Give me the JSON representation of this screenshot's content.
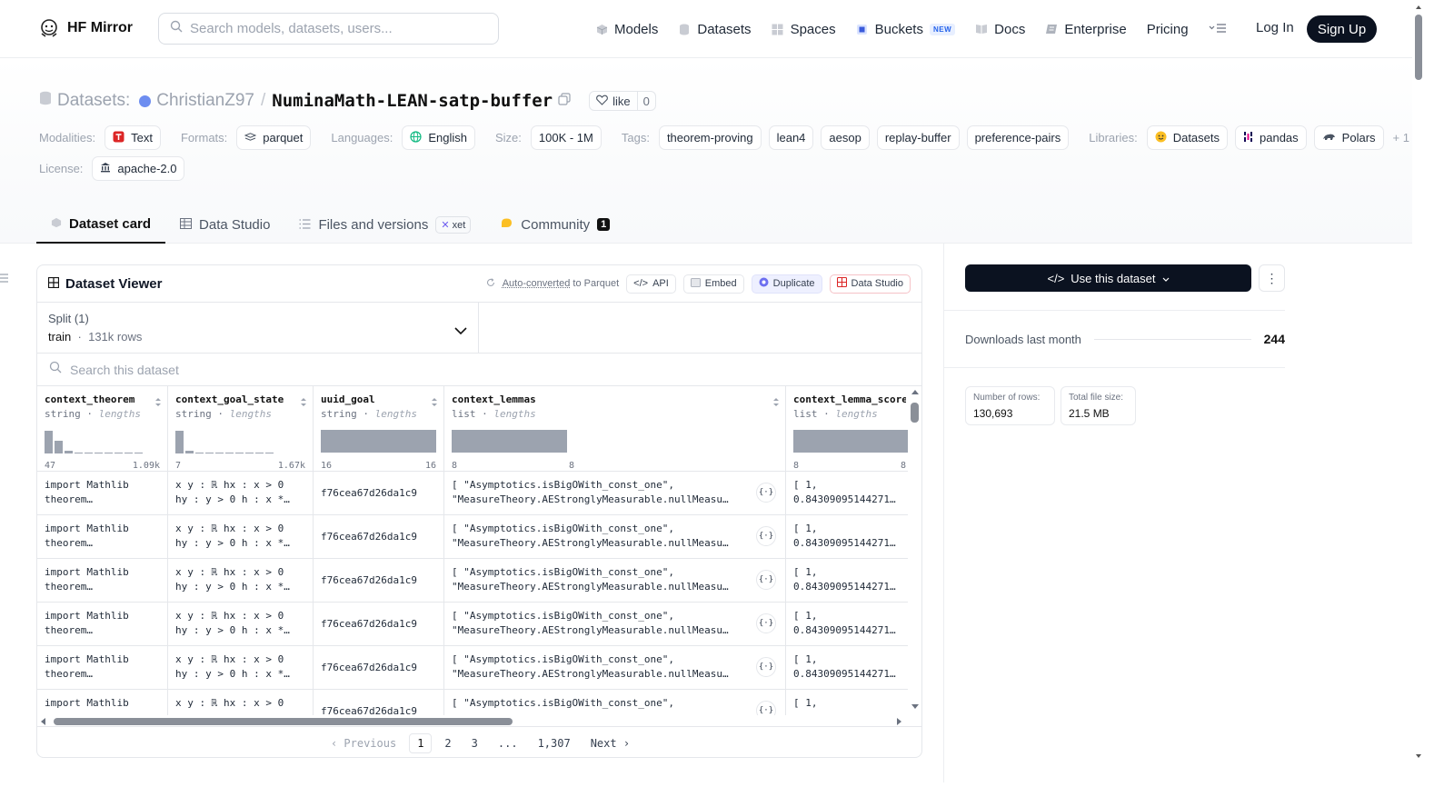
{
  "nav": {
    "brand": "HF Mirror",
    "search_placeholder": "Search models, datasets, users...",
    "links": [
      {
        "label": "Models",
        "icon": "cube-icon"
      },
      {
        "label": "Datasets",
        "icon": "database-icon"
      },
      {
        "label": "Spaces",
        "icon": "grid-icon"
      },
      {
        "label": "Buckets",
        "icon": "bucket-icon",
        "badge": "NEW"
      },
      {
        "label": "Docs",
        "icon": "book-icon"
      },
      {
        "label": "Enterprise",
        "icon": "enterprise-icon"
      },
      {
        "label": "Pricing"
      }
    ],
    "login": "Log In",
    "signup": "Sign Up"
  },
  "crumb": {
    "prefix": "Datasets:",
    "owner": "ChristianZ97",
    "name": "NuminaMath-LEAN-satp-buffer",
    "like_label": "like",
    "like_count": "0"
  },
  "meta": {
    "modalities_label": "Modalities:",
    "modality": "Text",
    "formats_label": "Formats:",
    "format": "parquet",
    "languages_label": "Languages:",
    "language": "English",
    "size_label": "Size:",
    "size": "100K - 1M",
    "tags_label": "Tags:",
    "tags": [
      "theorem-proving",
      "lean4",
      "aesop",
      "replay-buffer",
      "preference-pairs"
    ],
    "libraries_label": "Libraries:",
    "libraries": [
      "Datasets",
      "pandas",
      "Polars"
    ],
    "more_libraries": "+ 1",
    "license_label": "License:",
    "license": "apache-2.0"
  },
  "tabs": [
    {
      "label": "Dataset card",
      "active": true
    },
    {
      "label": "Data Studio"
    },
    {
      "label": "Files and versions",
      "badge": "xet"
    },
    {
      "label": "Community",
      "count": "1"
    }
  ],
  "viewer": {
    "title": "Dataset Viewer",
    "auto_converted": "Auto-converted",
    "to_parquet": "to Parquet",
    "api": "API",
    "embed": "Embed",
    "duplicate": "Duplicate",
    "data_studio": "Data Studio",
    "split_label": "Split (1)",
    "split_name": "train",
    "split_rows": "131k rows",
    "search_placeholder": "Search this dataset",
    "columns": [
      {
        "name": "context_theorem",
        "type": "string",
        "sub": "lengths",
        "min": "47",
        "max": "1.09k"
      },
      {
        "name": "context_goal_state",
        "type": "string",
        "sub": "lengths",
        "min": "7",
        "max": "1.67k"
      },
      {
        "name": "uuid_goal",
        "type": "string",
        "sub": "lengths",
        "min": "16",
        "max": "16"
      },
      {
        "name": "context_lemmas",
        "type": "list",
        "sub": "lengths",
        "min": "8",
        "max": "8"
      },
      {
        "name": "context_lemma_scores",
        "type": "list",
        "sub": "lengths",
        "min": "8",
        "max": "8"
      }
    ],
    "rows": [
      [
        "import Mathlib\ntheorem…",
        "x y : ℝ hx : x > 0\nhy : y > 0 h : x *…",
        "f76cea67d26da1c9",
        "[ \"Asymptotics.isBigOWith_const_one\",\n\"MeasureTheory.AEStronglyMeasurable.nullMeasu…",
        "[ 1,\n0.84309095144271…"
      ],
      [
        "import Mathlib\ntheorem…",
        "x y : ℝ hx : x > 0\nhy : y > 0 h : x *…",
        "f76cea67d26da1c9",
        "[ \"Asymptotics.isBigOWith_const_one\",\n\"MeasureTheory.AEStronglyMeasurable.nullMeasu…",
        "[ 1,\n0.84309095144271…"
      ],
      [
        "import Mathlib\ntheorem…",
        "x y : ℝ hx : x > 0\nhy : y > 0 h : x *…",
        "f76cea67d26da1c9",
        "[ \"Asymptotics.isBigOWith_const_one\",\n\"MeasureTheory.AEStronglyMeasurable.nullMeasu…",
        "[ 1,\n0.84309095144271…"
      ],
      [
        "import Mathlib\ntheorem…",
        "x y : ℝ hx : x > 0\nhy : y > 0 h : x *…",
        "f76cea67d26da1c9",
        "[ \"Asymptotics.isBigOWith_const_one\",\n\"MeasureTheory.AEStronglyMeasurable.nullMeasu…",
        "[ 1,\n0.84309095144271…"
      ],
      [
        "import Mathlib\ntheorem…",
        "x y : ℝ hx : x > 0\nhy : y > 0 h : x *…",
        "f76cea67d26da1c9",
        "[ \"Asymptotics.isBigOWith_const_one\",\n\"MeasureTheory.AEStronglyMeasurable.nullMeasu…",
        "[ 1,\n0.84309095144271…"
      ],
      [
        "import Mathlib",
        "x y : ℝ hx : x > 0",
        "f76cea67d26da1c9",
        "[ \"Asymptotics.isBigOWith_const_one\",",
        "[ 1,"
      ]
    ],
    "pager": {
      "prev": "Previous",
      "pages": [
        "1",
        "2",
        "3",
        "...",
        "1,307"
      ],
      "next": "Next"
    }
  },
  "sidebar": {
    "use_dataset": "Use this dataset",
    "downloads_label": "Downloads last month",
    "downloads": "244",
    "rows_label": "Number of rows:",
    "rows": "130,693",
    "size_label": "Total file size:",
    "size": "21.5 MB"
  }
}
